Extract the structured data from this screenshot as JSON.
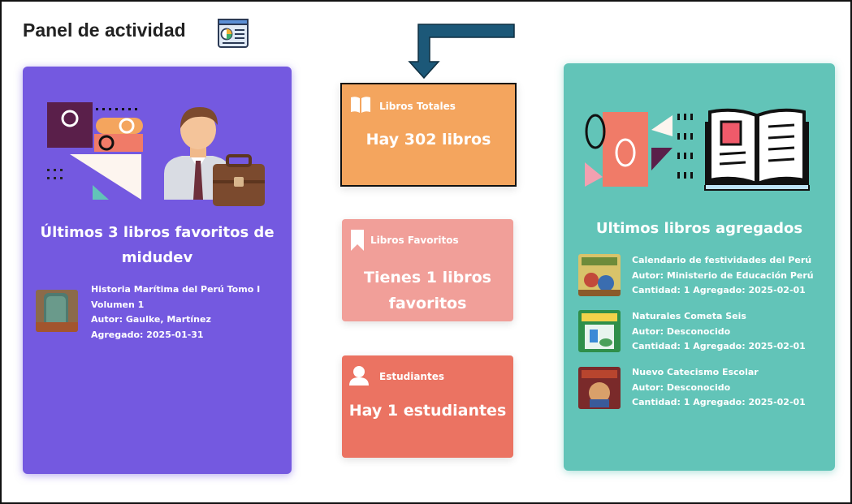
{
  "header": {
    "title": "Panel de actividad",
    "icon": "dashboard-chart-icon"
  },
  "stats": {
    "total": {
      "label": "Libros Totales",
      "value": "Hay 302 libros",
      "icon": "book-open-icon",
      "color": "#f4a55e"
    },
    "favorites": {
      "label": "Libros Favoritos",
      "value_line1": "Tienes 1 libros",
      "value_line2": "favoritos",
      "icon": "bookmark-icon",
      "color": "#f19f99"
    },
    "students": {
      "label": "Estudiantes",
      "value": "Hay 1 estudiantes",
      "icon": "user-icon",
      "color": "#eb7362"
    }
  },
  "favorites_panel": {
    "title_line1": "Últimos 3 libros favoritos de",
    "title_line2": "midudev",
    "color": "#7459e0",
    "books": [
      {
        "line1": "Historia Marítima del Perú Tomo I",
        "line2": "Volumen 1",
        "line3": "Autor: Gaulke, Martínez",
        "line4": "Agregado: 2025-01-31"
      }
    ]
  },
  "recent_panel": {
    "title": "Ultimos libros agregados",
    "color": "#62c4b8",
    "books": [
      {
        "title": "Calendario de festividades del Perú",
        "author": "Autor: Ministerio de Educación Perú",
        "meta": "Cantidad: 1  Agregado: 2025-02-01"
      },
      {
        "title": "Naturales Cometa Seis",
        "author": "Autor: Desconocido",
        "meta": "Cantidad: 1  Agregado: 2025-02-01"
      },
      {
        "title": "Nuevo Catecismo Escolar",
        "author": "Autor: Desconocido",
        "meta": "Cantidad: 1  Agregado: 2025-02-01"
      }
    ]
  }
}
